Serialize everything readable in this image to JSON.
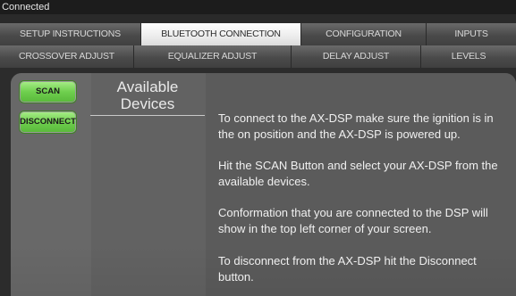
{
  "status": {
    "text": "t Connected"
  },
  "tabs_row1": [
    {
      "label": "SETUP INSTRUCTIONS",
      "active": false
    },
    {
      "label": "BLUETOOTH CONNECTION",
      "active": true
    },
    {
      "label": "CONFIGURATION",
      "active": false
    },
    {
      "label": "INPUTS",
      "active": false
    }
  ],
  "tabs_row2": [
    {
      "label": "CROSSOVER ADJUST"
    },
    {
      "label": "EQUALIZER ADJUST"
    },
    {
      "label": "DELAY ADJUST"
    },
    {
      "label": "LEVELS"
    }
  ],
  "buttons": {
    "scan": "SCAN",
    "disconnect": "DISCONNECT"
  },
  "devices": {
    "title_line1": "Available",
    "title_line2": "Devices"
  },
  "instructions": [
    "To connect to the AX-DSP make sure the ignition is in the on position and the AX-DSP is powered up.",
    "Hit the SCAN Button and select your AX-DSP from the available devices.",
    "Conformation that you are connected to the DSP will show in the top left corner of your screen.",
    "To disconnect from the AX-DSP hit the Disconnect button."
  ],
  "colors": {
    "button_green": "#6fcf4e",
    "active_tab": "#ececec",
    "panel": "#5b5b5b"
  }
}
